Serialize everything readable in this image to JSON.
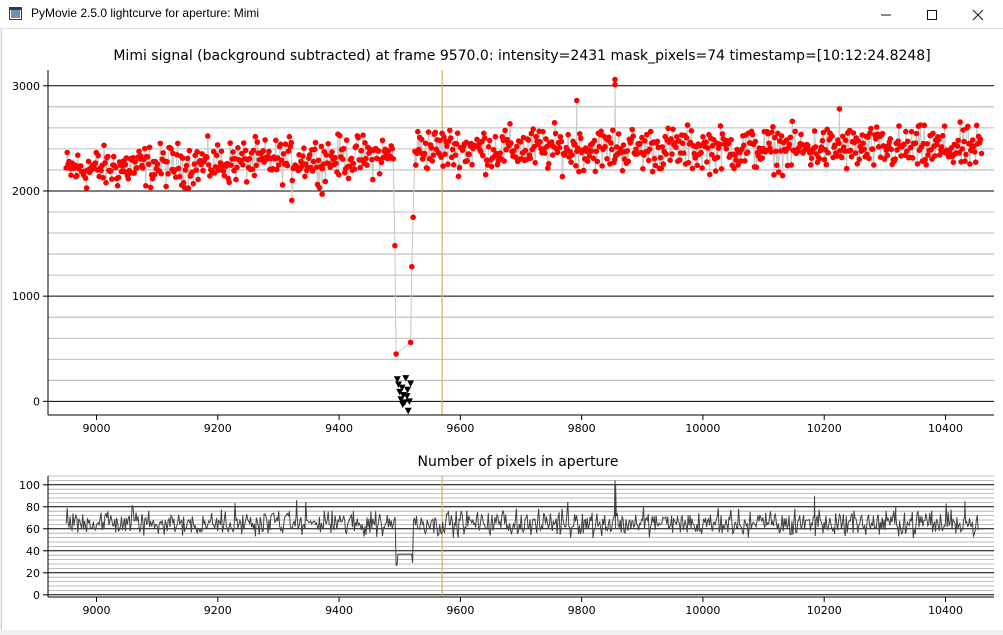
{
  "window": {
    "title": "PyMovie 2.5.0 lightcurve for aperture: Mimi",
    "minimize_icon": "minimize-icon",
    "maximize_icon": "maximize-icon",
    "close_icon": "close-icon"
  },
  "colors": {
    "signal_point": "#ff0000",
    "signal_line": "#c8c8c8",
    "dropout_marker": "#000000",
    "frame_cursor": "#d4b06a",
    "pixels_line": "#404040",
    "grid": "#a8a8a8"
  },
  "chart_data": [
    {
      "type": "scatter",
      "title": "Mimi signal (background subtracted) at frame 9570.0: intensity=2431 mask_pixels=74 timestamp=[10:12:24.8248]",
      "xlabel": "",
      "ylabel": "",
      "xlim": [
        8920,
        10480
      ],
      "ylim": [
        -130,
        3150
      ],
      "xticks": [
        9000,
        9200,
        9400,
        9600,
        9800,
        10000,
        10200,
        10400
      ],
      "yticks": [
        0,
        1000,
        2000,
        3000
      ],
      "frame_cursor_x": 9570,
      "grid": true,
      "series": [
        {
          "style": "red-dots-grey-line",
          "segments": [
            {
              "x_start": 8950,
              "x_end": 9490,
              "base": 2200,
              "spread": 260,
              "trend": 140
            },
            {
              "x_start": 9525,
              "x_end": 10460,
              "base": 2400,
              "spread": 270,
              "trend": 0
            }
          ],
          "extra_points": [
            [
              9492,
              1480
            ],
            [
              9494,
              450
            ],
            [
              9520,
              1280
            ],
            [
              9522,
              1750
            ],
            [
              9518,
              560
            ],
            [
              9855,
              3060
            ],
            [
              9855,
              3010
            ],
            [
              9792,
              2860
            ],
            [
              9322,
              1910
            ],
            [
              9372,
              1970
            ],
            [
              10225,
              2780
            ]
          ]
        },
        {
          "style": "black-triangles",
          "points": [
            [
              9496,
              210
            ],
            [
              9498,
              160
            ],
            [
              9500,
              90
            ],
            [
              9502,
              20
            ],
            [
              9504,
              130
            ],
            [
              9506,
              60
            ],
            [
              9508,
              -10
            ],
            [
              9510,
              220
            ],
            [
              9512,
              50
            ],
            [
              9514,
              -90
            ],
            [
              9516,
              0
            ],
            [
              9518,
              170
            ],
            [
              9505,
              -30
            ],
            [
              9513,
              110
            ]
          ]
        }
      ]
    },
    {
      "type": "line",
      "title": "Number of pixels in aperture",
      "xlabel": "",
      "ylabel": "",
      "xlim": [
        8920,
        10480
      ],
      "ylim": [
        -2,
        108
      ],
      "xticks": [
        9000,
        9200,
        9400,
        9600,
        9800,
        10000,
        10200,
        10400
      ],
      "yticks": [
        0,
        20,
        40,
        60,
        80,
        100
      ],
      "frame_cursor_x": 9570,
      "grid": true,
      "series": [
        {
          "style": "dark-line",
          "x_start": 8950,
          "x_end": 10455,
          "base": 65,
          "spread": 14,
          "dip": {
            "x_start": 9494,
            "x_end": 9522,
            "value": 37,
            "edges": [
              27,
              29
            ]
          },
          "spikes": [
            [
              9855,
              104
            ],
            [
              9856,
              100
            ],
            [
              9330,
              86
            ],
            [
              10184,
              90
            ],
            [
              10318,
              80
            ],
            [
              10432,
              85
            ]
          ]
        }
      ]
    }
  ]
}
